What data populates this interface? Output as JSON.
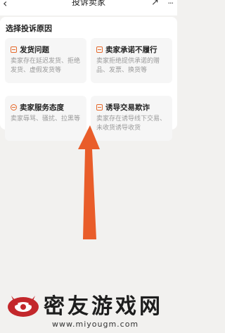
{
  "header": {
    "back_icon": "back-arrow-icon",
    "title": "投诉卖家",
    "share_icon": "share-icon",
    "more_icon": "more-icon"
  },
  "section": {
    "title": "选择投诉原因"
  },
  "reasons": [
    {
      "icon": "box-icon",
      "label": "发货问题",
      "desc": "卖家存在延迟发货、拒绝发货、虚假发货等"
    },
    {
      "icon": "document-icon",
      "label": "卖家承诺不履行",
      "desc": "卖家拒绝提供承诺的赠品、发票、换货等"
    },
    {
      "icon": "face-icon",
      "label": "卖家服务态度",
      "desc": "卖家辱骂、骚扰、拉黑等"
    },
    {
      "icon": "warning-icon",
      "label": "诱导交易欺诈",
      "desc": "卖家存在诱导线下交易、未收货诱导收货"
    }
  ],
  "annotation": {
    "color": "#e8541f"
  },
  "watermark": {
    "name": "密友游戏网",
    "url": "www.miyougm.com"
  },
  "colors": {
    "accent": "#e56a2c",
    "background": "#f2f1ef"
  }
}
